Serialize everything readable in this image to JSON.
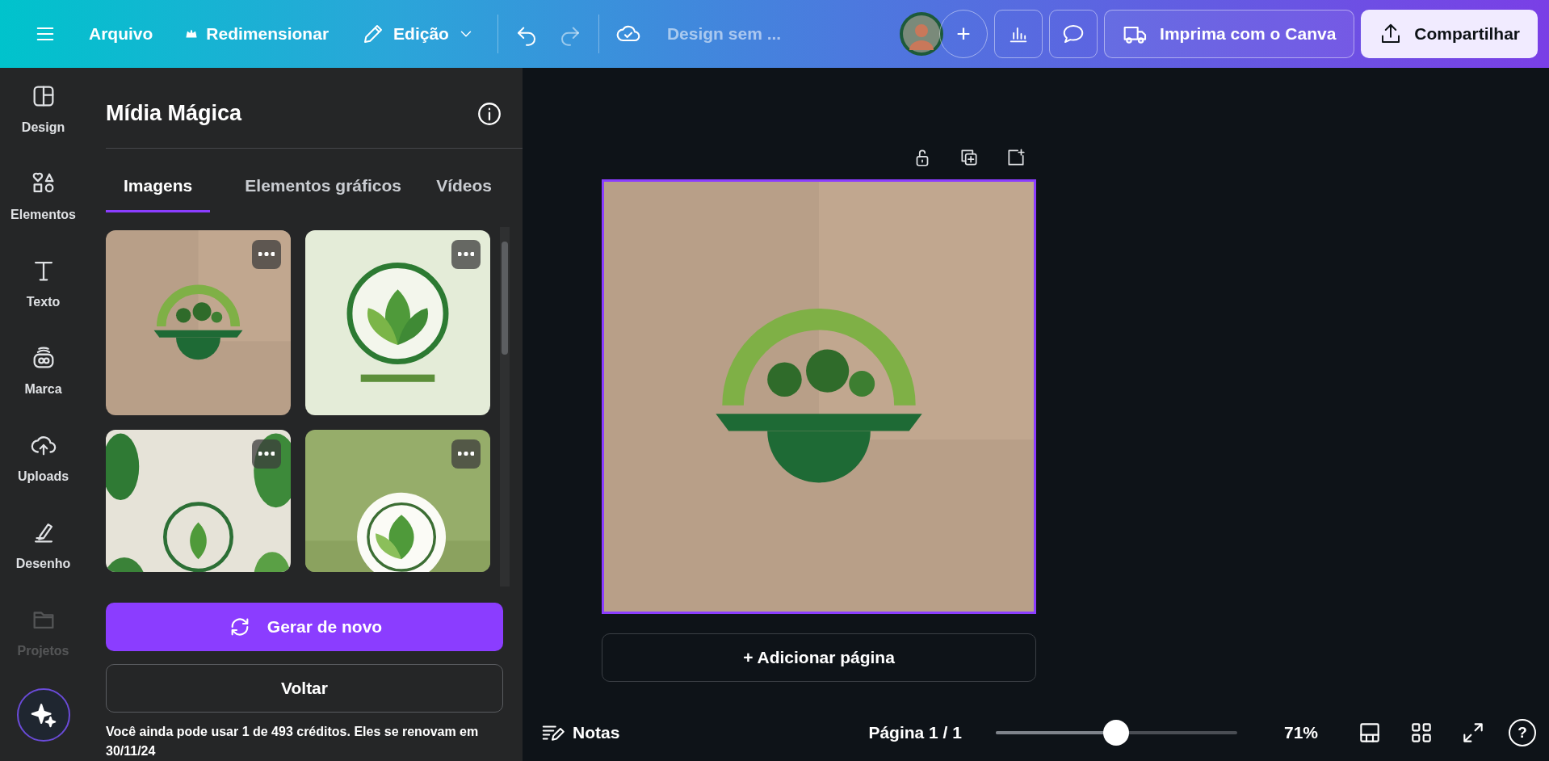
{
  "top_bar": {
    "menu": [
      {
        "label": "Arquivo",
        "kind": "plain"
      },
      {
        "label": "Redimensionar",
        "kind": "crown"
      },
      {
        "label": "Edição",
        "kind": "pencil"
      }
    ],
    "design_title": "Design sem ...",
    "add_symbol": "+",
    "print_button": "Imprima com o Canva",
    "share_button": "Compartilhar"
  },
  "rail": [
    {
      "label": "Design",
      "kind": "design",
      "faded": false
    },
    {
      "label": "Elementos",
      "kind": "shapes",
      "faded": false
    },
    {
      "label": "Texto",
      "kind": "text",
      "faded": false
    },
    {
      "label": "Marca",
      "kind": "brand",
      "faded": false
    },
    {
      "label": "Uploads",
      "kind": "upload",
      "faded": false
    },
    {
      "label": "Desenho",
      "kind": "draw",
      "faded": false
    },
    {
      "label": "Projetos",
      "kind": "folder",
      "faded": true
    }
  ],
  "panel": {
    "title": "Mídia Mágica",
    "tabs": [
      {
        "label": "Imagens",
        "selected": true
      },
      {
        "label": "Elementos gráficos",
        "selected": false
      },
      {
        "label": "Vídeos",
        "selected": false
      }
    ],
    "thumbnails": [
      {
        "kind": "picture"
      },
      {
        "kind": "picture"
      },
      {
        "kind": "picture"
      },
      {
        "kind": "picture"
      }
    ],
    "regenerate_button": "Gerar de novo",
    "back_button": "Voltar",
    "credits_note": "Você ainda pode usar 1 de 493 créditos. Eles se renovam em 30/11/24"
  },
  "canvas": {
    "page": {
      "kind": "picture",
      "selected": true
    },
    "add_page_button": "+ Adicionar página"
  },
  "bottom_bar": {
    "notes": "Notas",
    "page_indicator": "Página 1 / 1",
    "zoom": {
      "level": 0.5
    },
    "zoom_reading": "71%",
    "help": "?"
  }
}
